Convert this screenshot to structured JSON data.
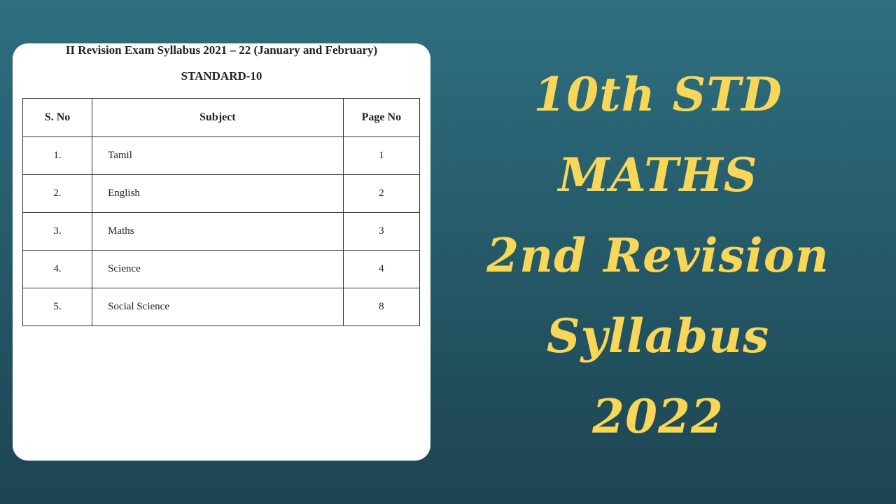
{
  "document": {
    "title": "II Revision Exam Syllabus 2021 – 22 (January and February)",
    "subtitle": "STANDARD-10",
    "table": {
      "headers": [
        "S. No",
        "Subject",
        "Page No"
      ],
      "rows": [
        {
          "sno": "1.",
          "subject": "Tamil",
          "page": "1"
        },
        {
          "sno": "2.",
          "subject": "English",
          "page": "2"
        },
        {
          "sno": "3.",
          "subject": "Maths",
          "page": "3"
        },
        {
          "sno": "4.",
          "subject": "Science",
          "page": "4"
        },
        {
          "sno": "5.",
          "subject": "Social Science",
          "page": "8"
        }
      ]
    }
  },
  "headline": {
    "lines": [
      "10th STD",
      "MATHS",
      "2nd Revision",
      "Syllabus",
      "2022"
    ]
  },
  "colors": {
    "background": "#2a6474",
    "headline": "#f7d658",
    "card": "#ffffff"
  }
}
